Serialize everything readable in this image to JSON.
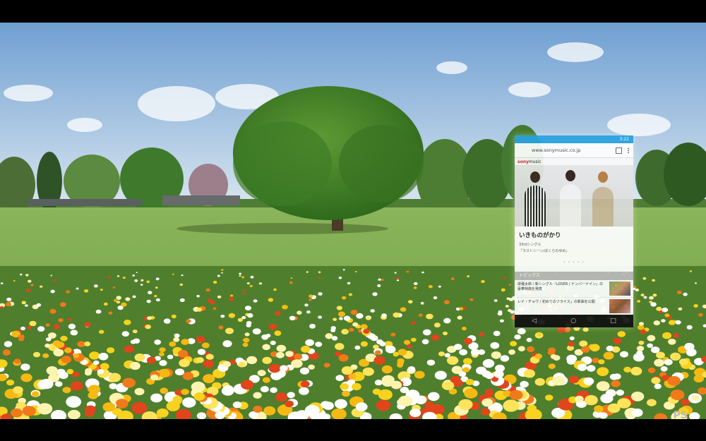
{
  "scene": {
    "description_icons": [
      "tree-icon",
      "flower-field"
    ]
  },
  "phone": {
    "status_text": "3:22",
    "url": "www.sonymusic.co.jp",
    "site_logo_prefix": "sony",
    "site_logo_suffix": "music",
    "artist_name": "いきものがかり",
    "article_line1": "33rdシングル",
    "article_line2": "「ラストシーン/ぼくらのゆめ」",
    "carousel_dots": "• • • • •",
    "topics_header": "トピックス",
    "topics": [
      {
        "text": "岸優太郎 / 新シングル「LOSER / ナンバーナイン」の豪華特典を発表"
      },
      {
        "text": "レイ・チョウ / 初めてのフライス」の新曲を公開"
      }
    ],
    "nav_back": "◁",
    "nav_home": "○",
    "nav_recent": "□"
  },
  "ps_logo": "PS",
  "colors": {
    "sky_top": "#6fa2d6",
    "sky_bottom": "#d6e6f2",
    "grass": "#7fae4a",
    "status_bar": "#2aa3e0"
  }
}
